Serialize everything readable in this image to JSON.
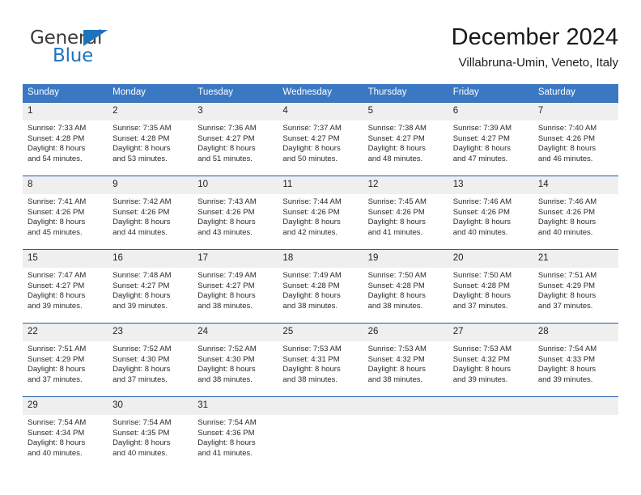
{
  "brand": {
    "name_part1": "General",
    "name_part2": "Blue",
    "triangle_icon": "blue-triangle-icon",
    "accent_color": "#1c74bd"
  },
  "header": {
    "title": "December 2024",
    "subtitle": "Villabruna-Umin, Veneto, Italy"
  },
  "theme": {
    "header_bg": "#3b78c3",
    "row_divider": "#1f5fa9",
    "daynum_bg": "#efefef"
  },
  "calendar": {
    "weekday_headers": [
      "Sunday",
      "Monday",
      "Tuesday",
      "Wednesday",
      "Thursday",
      "Friday",
      "Saturday"
    ],
    "weeks": [
      [
        {
          "day": "1",
          "sunrise": "Sunrise: 7:33 AM",
          "sunset": "Sunset: 4:28 PM",
          "daylight1": "Daylight: 8 hours",
          "daylight2": "and 54 minutes."
        },
        {
          "day": "2",
          "sunrise": "Sunrise: 7:35 AM",
          "sunset": "Sunset: 4:28 PM",
          "daylight1": "Daylight: 8 hours",
          "daylight2": "and 53 minutes."
        },
        {
          "day": "3",
          "sunrise": "Sunrise: 7:36 AM",
          "sunset": "Sunset: 4:27 PM",
          "daylight1": "Daylight: 8 hours",
          "daylight2": "and 51 minutes."
        },
        {
          "day": "4",
          "sunrise": "Sunrise: 7:37 AM",
          "sunset": "Sunset: 4:27 PM",
          "daylight1": "Daylight: 8 hours",
          "daylight2": "and 50 minutes."
        },
        {
          "day": "5",
          "sunrise": "Sunrise: 7:38 AM",
          "sunset": "Sunset: 4:27 PM",
          "daylight1": "Daylight: 8 hours",
          "daylight2": "and 48 minutes."
        },
        {
          "day": "6",
          "sunrise": "Sunrise: 7:39 AM",
          "sunset": "Sunset: 4:27 PM",
          "daylight1": "Daylight: 8 hours",
          "daylight2": "and 47 minutes."
        },
        {
          "day": "7",
          "sunrise": "Sunrise: 7:40 AM",
          "sunset": "Sunset: 4:26 PM",
          "daylight1": "Daylight: 8 hours",
          "daylight2": "and 46 minutes."
        }
      ],
      [
        {
          "day": "8",
          "sunrise": "Sunrise: 7:41 AM",
          "sunset": "Sunset: 4:26 PM",
          "daylight1": "Daylight: 8 hours",
          "daylight2": "and 45 minutes."
        },
        {
          "day": "9",
          "sunrise": "Sunrise: 7:42 AM",
          "sunset": "Sunset: 4:26 PM",
          "daylight1": "Daylight: 8 hours",
          "daylight2": "and 44 minutes."
        },
        {
          "day": "10",
          "sunrise": "Sunrise: 7:43 AM",
          "sunset": "Sunset: 4:26 PM",
          "daylight1": "Daylight: 8 hours",
          "daylight2": "and 43 minutes."
        },
        {
          "day": "11",
          "sunrise": "Sunrise: 7:44 AM",
          "sunset": "Sunset: 4:26 PM",
          "daylight1": "Daylight: 8 hours",
          "daylight2": "and 42 minutes."
        },
        {
          "day": "12",
          "sunrise": "Sunrise: 7:45 AM",
          "sunset": "Sunset: 4:26 PM",
          "daylight1": "Daylight: 8 hours",
          "daylight2": "and 41 minutes."
        },
        {
          "day": "13",
          "sunrise": "Sunrise: 7:46 AM",
          "sunset": "Sunset: 4:26 PM",
          "daylight1": "Daylight: 8 hours",
          "daylight2": "and 40 minutes."
        },
        {
          "day": "14",
          "sunrise": "Sunrise: 7:46 AM",
          "sunset": "Sunset: 4:26 PM",
          "daylight1": "Daylight: 8 hours",
          "daylight2": "and 40 minutes."
        }
      ],
      [
        {
          "day": "15",
          "sunrise": "Sunrise: 7:47 AM",
          "sunset": "Sunset: 4:27 PM",
          "daylight1": "Daylight: 8 hours",
          "daylight2": "and 39 minutes."
        },
        {
          "day": "16",
          "sunrise": "Sunrise: 7:48 AM",
          "sunset": "Sunset: 4:27 PM",
          "daylight1": "Daylight: 8 hours",
          "daylight2": "and 39 minutes."
        },
        {
          "day": "17",
          "sunrise": "Sunrise: 7:49 AM",
          "sunset": "Sunset: 4:27 PM",
          "daylight1": "Daylight: 8 hours",
          "daylight2": "and 38 minutes."
        },
        {
          "day": "18",
          "sunrise": "Sunrise: 7:49 AM",
          "sunset": "Sunset: 4:28 PM",
          "daylight1": "Daylight: 8 hours",
          "daylight2": "and 38 minutes."
        },
        {
          "day": "19",
          "sunrise": "Sunrise: 7:50 AM",
          "sunset": "Sunset: 4:28 PM",
          "daylight1": "Daylight: 8 hours",
          "daylight2": "and 38 minutes."
        },
        {
          "day": "20",
          "sunrise": "Sunrise: 7:50 AM",
          "sunset": "Sunset: 4:28 PM",
          "daylight1": "Daylight: 8 hours",
          "daylight2": "and 37 minutes."
        },
        {
          "day": "21",
          "sunrise": "Sunrise: 7:51 AM",
          "sunset": "Sunset: 4:29 PM",
          "daylight1": "Daylight: 8 hours",
          "daylight2": "and 37 minutes."
        }
      ],
      [
        {
          "day": "22",
          "sunrise": "Sunrise: 7:51 AM",
          "sunset": "Sunset: 4:29 PM",
          "daylight1": "Daylight: 8 hours",
          "daylight2": "and 37 minutes."
        },
        {
          "day": "23",
          "sunrise": "Sunrise: 7:52 AM",
          "sunset": "Sunset: 4:30 PM",
          "daylight1": "Daylight: 8 hours",
          "daylight2": "and 37 minutes."
        },
        {
          "day": "24",
          "sunrise": "Sunrise: 7:52 AM",
          "sunset": "Sunset: 4:30 PM",
          "daylight1": "Daylight: 8 hours",
          "daylight2": "and 38 minutes."
        },
        {
          "day": "25",
          "sunrise": "Sunrise: 7:53 AM",
          "sunset": "Sunset: 4:31 PM",
          "daylight1": "Daylight: 8 hours",
          "daylight2": "and 38 minutes."
        },
        {
          "day": "26",
          "sunrise": "Sunrise: 7:53 AM",
          "sunset": "Sunset: 4:32 PM",
          "daylight1": "Daylight: 8 hours",
          "daylight2": "and 38 minutes."
        },
        {
          "day": "27",
          "sunrise": "Sunrise: 7:53 AM",
          "sunset": "Sunset: 4:32 PM",
          "daylight1": "Daylight: 8 hours",
          "daylight2": "and 39 minutes."
        },
        {
          "day": "28",
          "sunrise": "Sunrise: 7:54 AM",
          "sunset": "Sunset: 4:33 PM",
          "daylight1": "Daylight: 8 hours",
          "daylight2": "and 39 minutes."
        }
      ],
      [
        {
          "day": "29",
          "sunrise": "Sunrise: 7:54 AM",
          "sunset": "Sunset: 4:34 PM",
          "daylight1": "Daylight: 8 hours",
          "daylight2": "and 40 minutes."
        },
        {
          "day": "30",
          "sunrise": "Sunrise: 7:54 AM",
          "sunset": "Sunset: 4:35 PM",
          "daylight1": "Daylight: 8 hours",
          "daylight2": "and 40 minutes."
        },
        {
          "day": "31",
          "sunrise": "Sunrise: 7:54 AM",
          "sunset": "Sunset: 4:36 PM",
          "daylight1": "Daylight: 8 hours",
          "daylight2": "and 41 minutes."
        },
        {
          "day": "",
          "sunrise": "",
          "sunset": "",
          "daylight1": "",
          "daylight2": ""
        },
        {
          "day": "",
          "sunrise": "",
          "sunset": "",
          "daylight1": "",
          "daylight2": ""
        },
        {
          "day": "",
          "sunrise": "",
          "sunset": "",
          "daylight1": "",
          "daylight2": ""
        },
        {
          "day": "",
          "sunrise": "",
          "sunset": "",
          "daylight1": "",
          "daylight2": ""
        }
      ]
    ]
  }
}
